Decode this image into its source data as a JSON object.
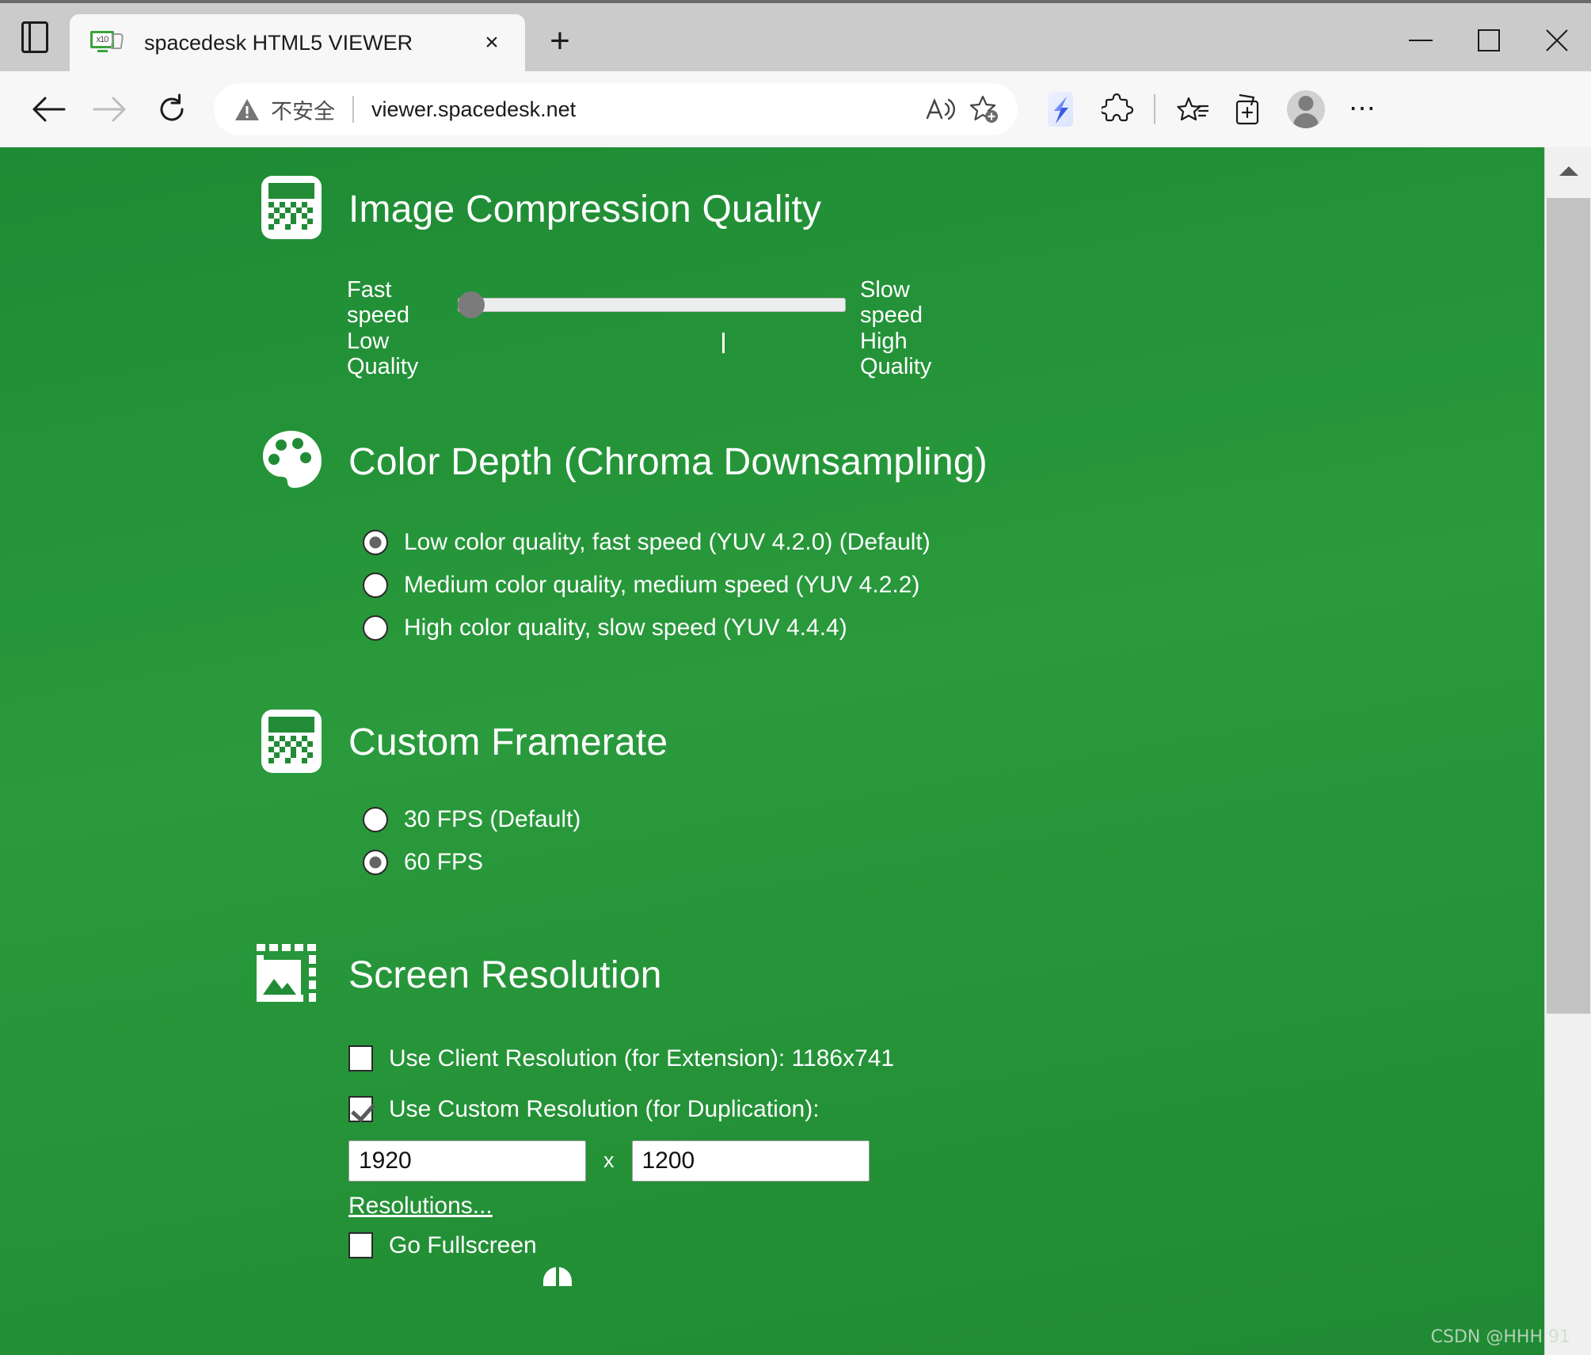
{
  "window": {
    "minimize_label": "Minimize",
    "maximize_label": "Maximize",
    "close_label": "Close"
  },
  "browser": {
    "tab_search_icon": "tab-search-icon",
    "tab": {
      "title": "spacedesk HTML5 VIEWER",
      "favicon_text": "x10",
      "close_label": "×"
    },
    "new_tab_label": "+",
    "nav": {
      "back_label": "Back",
      "forward_label": "Forward",
      "refresh_label": "Refresh"
    },
    "omnibox": {
      "security_text": "不安全",
      "url": "viewer.spacedesk.net",
      "read_aloud_label": "Read aloud",
      "favorite_label": "Add this page to favorites"
    },
    "toolbar": {
      "app_icon_label": "browser-essentials",
      "extensions_label": "Extensions",
      "collections_label": "Collections",
      "split_screen_label": "Split screen",
      "profile_label": "Profile",
      "settings_label": "Settings and more"
    }
  },
  "page": {
    "sections": [
      {
        "id": "image-compression-quality",
        "title": "Image Compression Quality",
        "icon": "dither-icon",
        "slider": {
          "left_label": "Fast speed\nLow\nQuality",
          "left_label_lines": [
            "Fast speed",
            "Low",
            "Quality"
          ],
          "right_label_lines": [
            "Slow",
            "speed",
            "High",
            "Quality"
          ],
          "value": 0,
          "min": 0,
          "max": 100
        }
      },
      {
        "id": "color-depth",
        "title": "Color Depth (Chroma Downsampling)",
        "icon": "palette-icon",
        "options": [
          {
            "label": "Low color quality, fast speed (YUV 4.2.0) (Default)",
            "selected": true
          },
          {
            "label": "Medium color quality, medium speed (YUV 4.2.2)",
            "selected": false
          },
          {
            "label": "High color quality, slow speed (YUV 4.4.4)",
            "selected": false
          }
        ]
      },
      {
        "id": "custom-framerate",
        "title": "Custom Framerate",
        "icon": "dither-icon",
        "options": [
          {
            "label": "30 FPS (Default)",
            "selected": false
          },
          {
            "label": "60 FPS",
            "selected": true
          }
        ]
      },
      {
        "id": "screen-resolution",
        "title": "Screen Resolution",
        "icon": "screen-resolution-icon",
        "client_resolution": {
          "label": "Use Client Resolution (for Extension): 1186x741",
          "checked": false
        },
        "custom_resolution": {
          "label": "Use Custom Resolution (for Duplication):",
          "checked": true,
          "width": "1920",
          "height": "1200",
          "separator": "x",
          "resolutions_link": "Resolutions..."
        },
        "fullscreen": {
          "label": "Go Fullscreen",
          "checked": false
        }
      }
    ]
  },
  "watermark": "CSDN @HHH 91",
  "colors": {
    "page_background": "#228b36",
    "accent_white": "#ffffff",
    "control_gray": "#7b7b7b",
    "chrome_background": "#f7f7f7",
    "titlebar_background": "#cbcbcb"
  }
}
